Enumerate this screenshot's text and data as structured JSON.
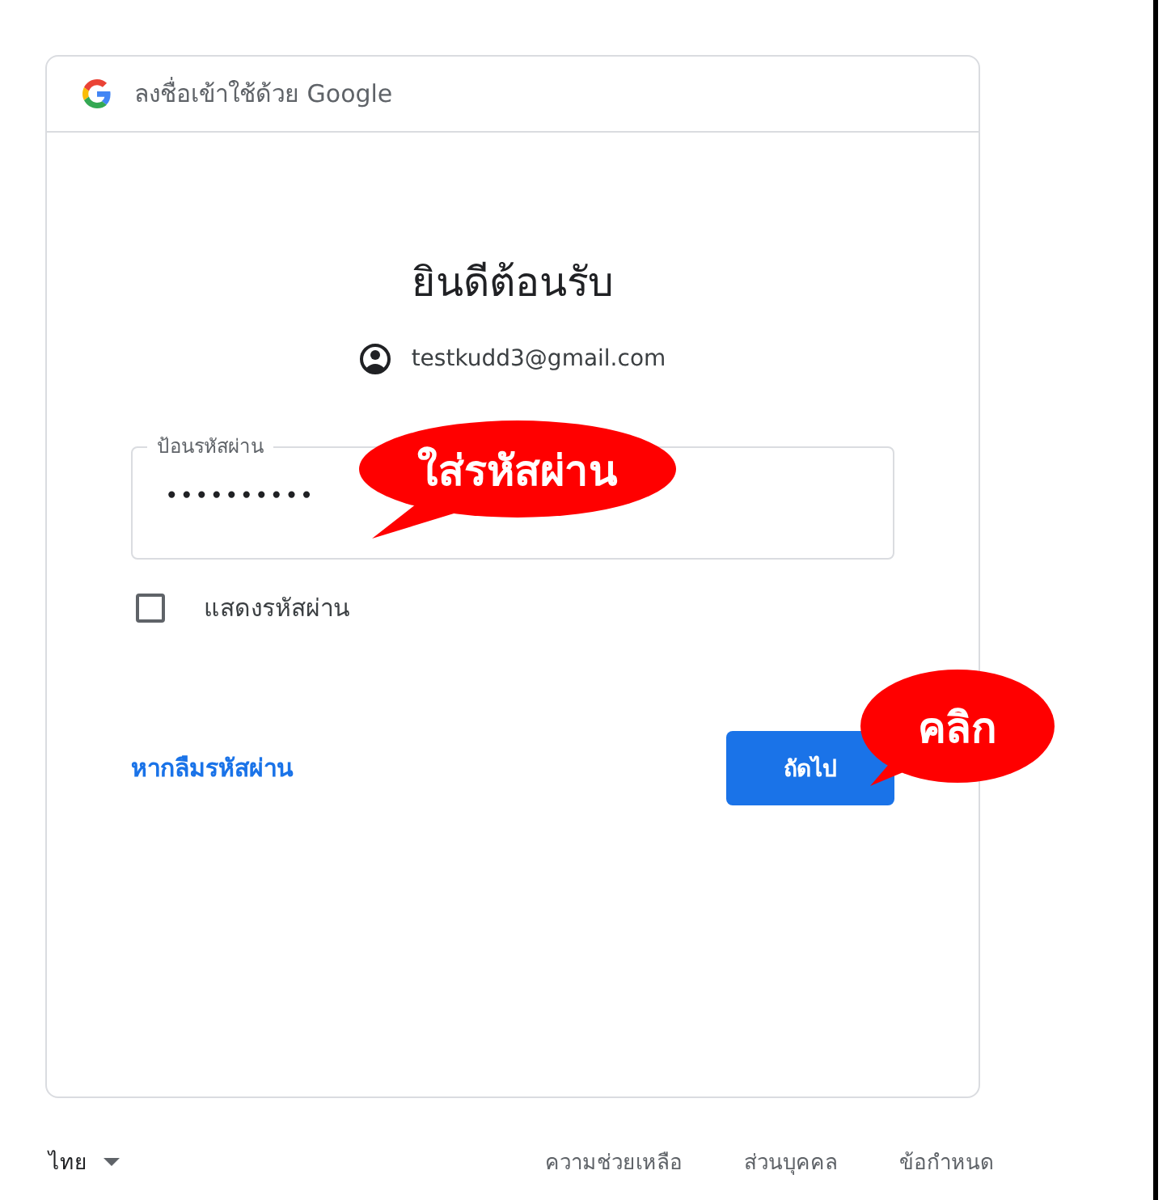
{
  "card": {
    "header": "ลงชื่อเข้าใช้ด้วย Google",
    "title": "ยินดีต้อนรับ",
    "account": "testkudd3@gmail.com",
    "password_field": {
      "label": "ป้อนรหัสผ่าน",
      "value": "••••••••••"
    },
    "show_password": {
      "label": "แสดงรหัสผ่าน",
      "checked": false
    },
    "forgot_link": "หากลืมรหัสผ่าน",
    "next_button": "ถัดไป"
  },
  "footer": {
    "language": "ไทย",
    "links": [
      "ความช่วยเหลือ",
      "ส่วนบุคคล",
      "ข้อกำหนด"
    ]
  },
  "annotations": [
    {
      "kind": "callout",
      "text": "ใส่รหัสผ่าน"
    },
    {
      "kind": "callout",
      "text": "คลิก"
    }
  ]
}
